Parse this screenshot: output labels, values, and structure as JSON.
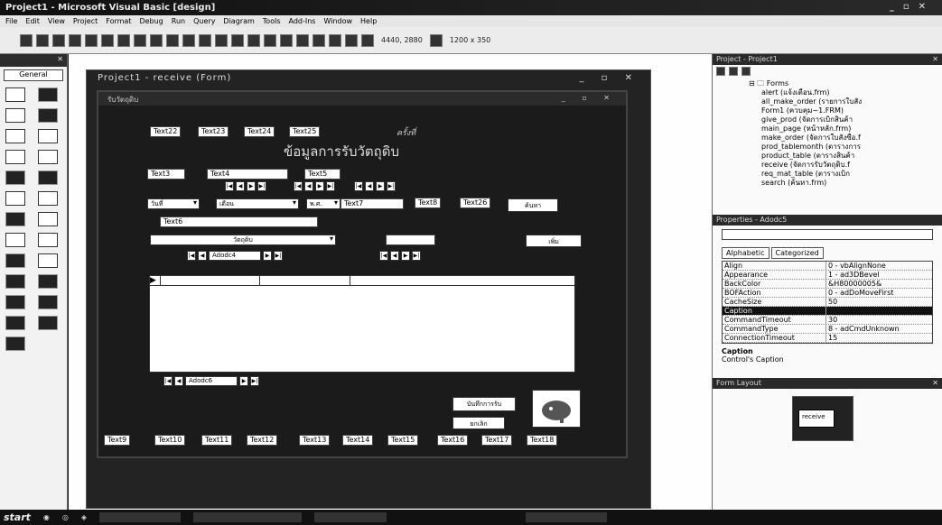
{
  "window": {
    "title": "Project1 - Microsoft Visual Basic [design]",
    "controls": [
      "_",
      "▫",
      "✕"
    ]
  },
  "menu": [
    "File",
    "Edit",
    "View",
    "Project",
    "Format",
    "Debug",
    "Run",
    "Query",
    "Diagram",
    "Tools",
    "Add-Ins",
    "Window",
    "Help"
  ],
  "toolbar": {
    "position": "4440, 2880",
    "size": "1200 x 350"
  },
  "toolbox": {
    "tab_label": "General"
  },
  "project_window": {
    "title": "Project1 - receive (Form)"
  },
  "form": {
    "title": "รับวัตถุดิบ",
    "heading": "ข้อมูลการรับวัตถุดิบ",
    "number_label": "ครั้งที่",
    "top_textboxes": [
      "Text22",
      "Text23",
      "Text24",
      "Text25"
    ],
    "row2_textboxes": [
      "Text3",
      "Text4",
      "Text5"
    ],
    "row3": {
      "combo1": "วันที่",
      "combo2": "เดือน",
      "date_label": "พ.ศ.",
      "text7": "Text7",
      "text8": "Text8",
      "text26": "Text26",
      "button": "ค้นหา"
    },
    "text6": "Text6",
    "combo_main": "วัตถุดิบ",
    "button_add": "เพิ่ม",
    "adodc4": "Adodc4",
    "adodc6": "Adodc6",
    "save_button": "บันทึกการรับ",
    "cancel_button": "ยกเลิก",
    "bottom_textboxes": [
      "Text9",
      "Text10",
      "Text11",
      "Text12",
      "Text13",
      "Text14",
      "Text15",
      "Text16",
      "Text17",
      "Text18"
    ]
  },
  "project_explorer": {
    "title": "Project - Project1",
    "root": "Forms",
    "items": [
      "alert (แจ้งเตือน.frm)",
      "all_make_order (รายการใบสั่ง",
      "Form1 (ควบคุม~1.FRM)",
      "give_prod (จัดการเบิกสินค้า",
      "main_page (หน้าหลัก.frm)",
      "make_order (จัดการใบสั่งซื้อ.f",
      "prod_tablemonth (ตารางการ",
      "product_table (ตารางสินค้า",
      "receive (จัดการรับวัตถุดิบ.f",
      "req_mat_table (ตารางเบิก",
      "search (ค้นหา.frm)"
    ]
  },
  "properties": {
    "title": "Properties - Adodc5",
    "tabs": [
      "Alphabetic",
      "Categorized"
    ],
    "rows": [
      {
        "name": "Align",
        "value": "0 - vbAlignNone"
      },
      {
        "name": "Appearance",
        "value": "1 - ad3DBevel"
      },
      {
        "name": "BackColor",
        "value": "&H80000005&"
      },
      {
        "name": "BOFAction",
        "value": "0 - adDoMoveFirst"
      },
      {
        "name": "CacheSize",
        "value": "50"
      },
      {
        "name": "Caption",
        "value": ""
      },
      {
        "name": "CommandTimeout",
        "value": "30"
      },
      {
        "name": "CommandType",
        "value": "8 - adCmdUnknown"
      },
      {
        "name": "ConnectionTimeout",
        "value": "15"
      }
    ],
    "desc_title": "Caption",
    "desc_text": "Control's Caption"
  },
  "form_layout": {
    "title": "Form Layout",
    "preview_label": "receive"
  },
  "taskbar": {
    "start": "start"
  },
  "colors": {
    "titlebar": "#101010",
    "form_bg": "#1b1b1b",
    "highlight": "#111111"
  }
}
